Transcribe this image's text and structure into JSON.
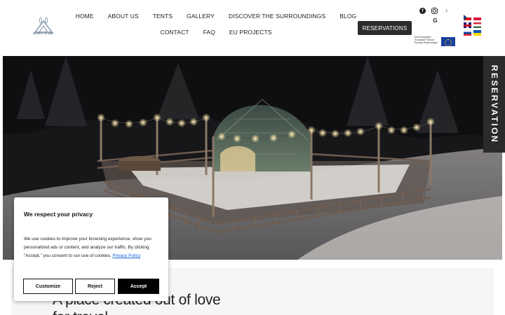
{
  "brand": {
    "logo_text": "BUNNY GLAMP"
  },
  "nav": {
    "row1": [
      "HOME",
      "ABOUT US",
      "TENTS",
      "GALLERY",
      "DISCOVER THE SURROUNDINGS",
      "BLOG"
    ],
    "row2": [
      "CONTACT",
      "FAQ",
      "EU PROJECTS"
    ],
    "reservations_label": "RESERVATIONS"
  },
  "social": {
    "facebook_icon": "facebook-icon",
    "instagram_icon": "instagram-icon",
    "tiktok_icon": "tiktok-icon",
    "google_icon": "google-icon",
    "tiktok_glyph": "♪",
    "google_glyph": "G",
    "facebook_glyph": "f"
  },
  "eu_banner": {
    "text": "Unia Europejska Europejski Fundusz Rozwoju Regionalnego"
  },
  "languages": [
    "cz",
    "pl",
    "gb",
    "hu",
    "sk",
    "ua"
  ],
  "side_tab": {
    "label": "RESERVATION"
  },
  "hero": {
    "background_color": "#1a1a1c"
  },
  "section": {
    "title_line1": "A place created out of love",
    "title_line2": "for travel"
  },
  "cookie": {
    "title": "We respect your privacy",
    "text": "We use cookies to improve your browsing experience, show you personalized ads or content, and analyze our traffic. By clicking \"Accept,\" you consent to our use of cookies.",
    "policy_link": "Privacy Policy",
    "customize_label": "Customize",
    "reject_label": "Reject",
    "accept_label": "Accept"
  },
  "colors": {
    "dark_button": "#2c2c2c",
    "accent_link": "#1863dc",
    "accept_bg": "#000000"
  }
}
